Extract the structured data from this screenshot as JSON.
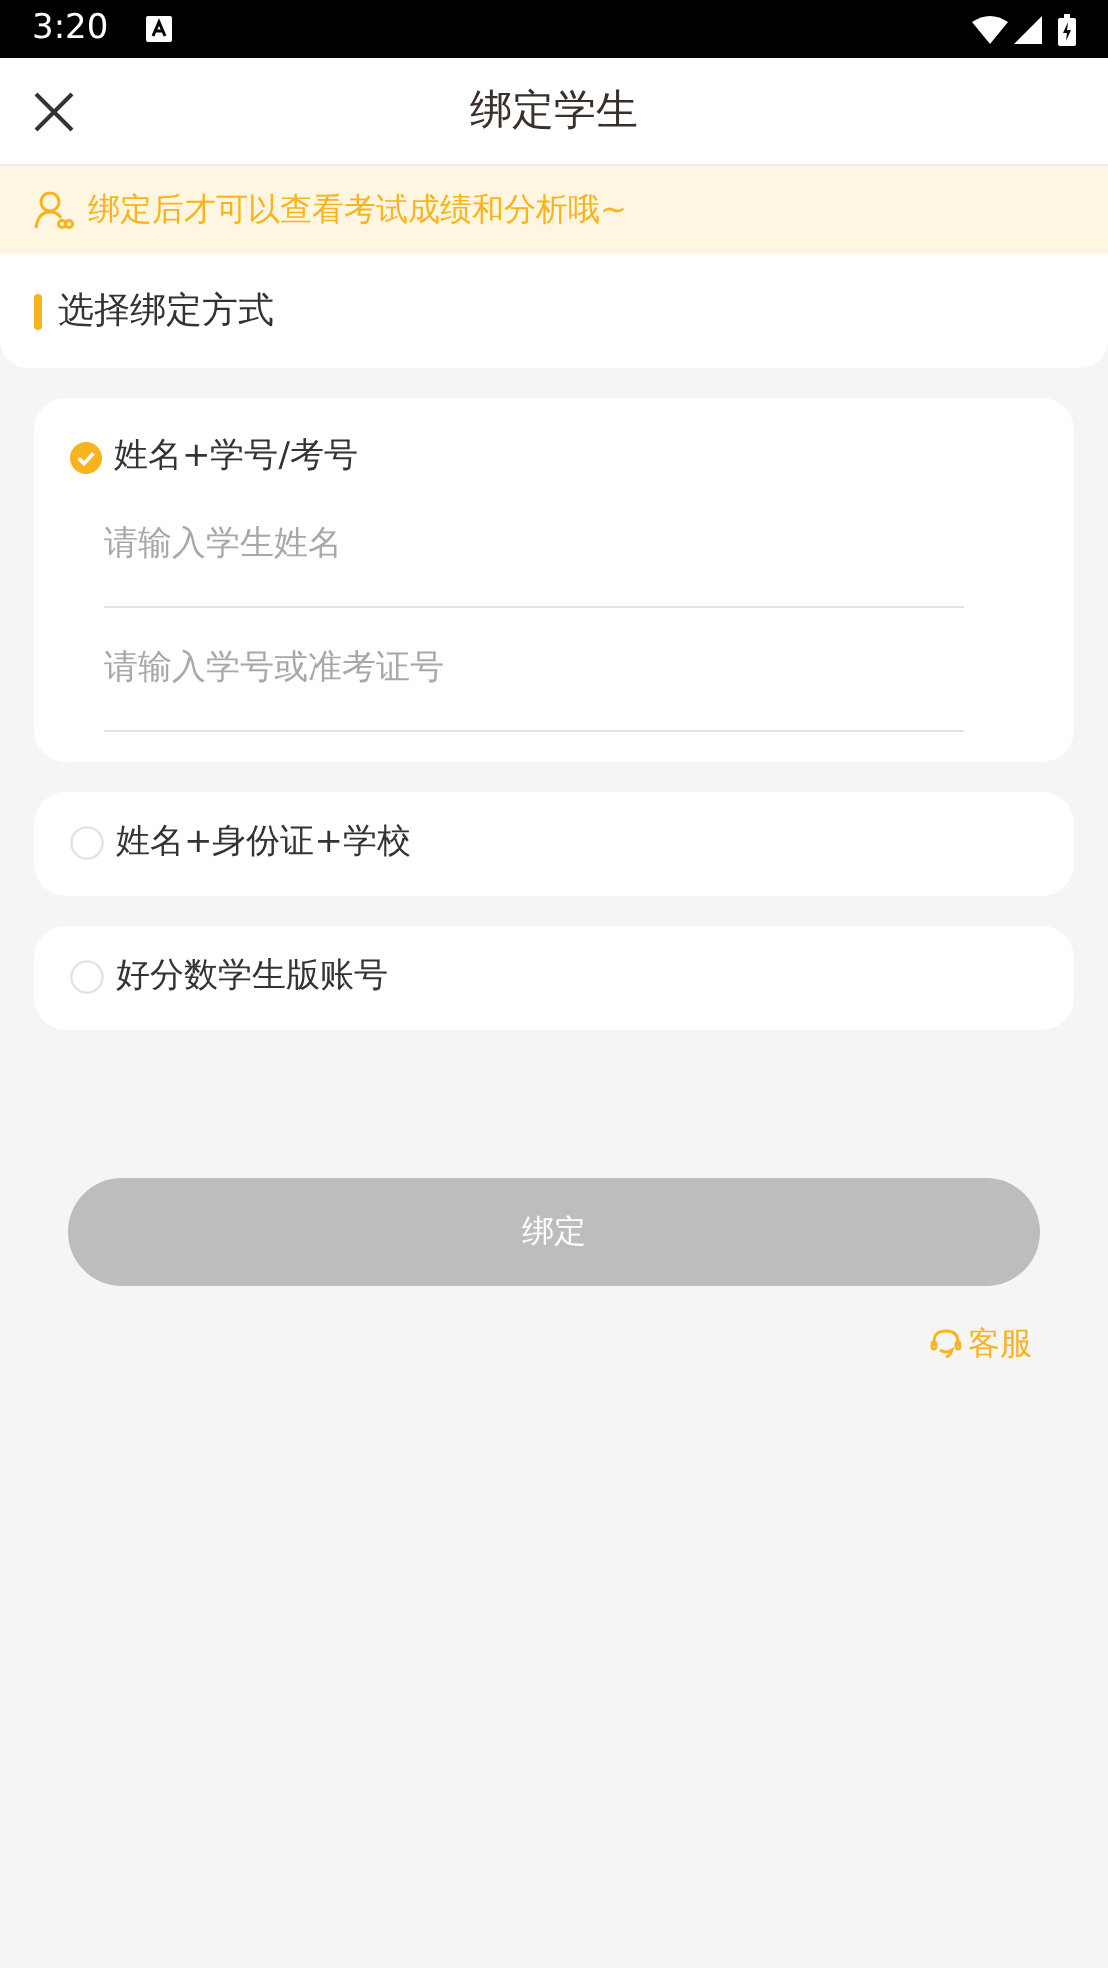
{
  "status_bar": {
    "time": "3:20"
  },
  "header": {
    "title": "绑定学生"
  },
  "notice": {
    "text": "绑定后才可以查看考试成绩和分析哦~"
  },
  "section": {
    "title": "选择绑定方式"
  },
  "options": [
    {
      "label": "姓名+学号/考号",
      "selected": true,
      "fields": [
        {
          "placeholder": "请输入学生姓名"
        },
        {
          "placeholder": "请输入学号或准考证号"
        }
      ]
    },
    {
      "label": "姓名+身份证+学校",
      "selected": false
    },
    {
      "label": "好分数学生版账号",
      "selected": false
    }
  ],
  "bind_button": {
    "label": "绑定",
    "disabled": true
  },
  "support_link": {
    "label": "客服"
  }
}
